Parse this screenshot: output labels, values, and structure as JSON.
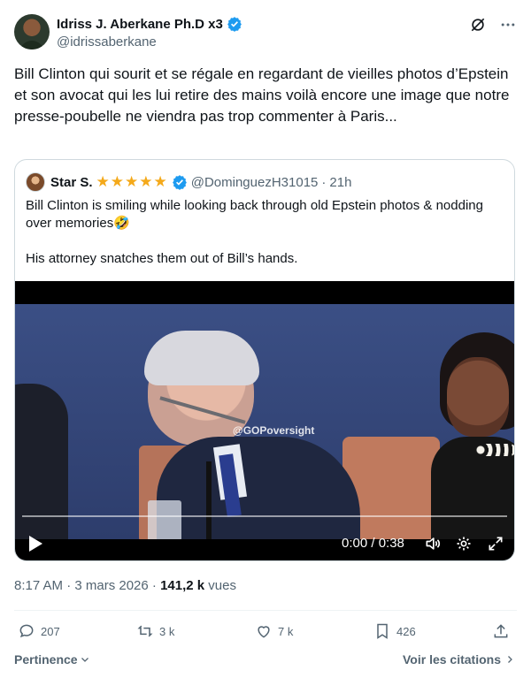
{
  "author": {
    "name": "Idriss J. Aberkane Ph.D x3",
    "handle": "@idrissaberkane"
  },
  "tweet": {
    "text": "Bill Clinton qui sourit et se régale en regardant de vieilles photos d’Epstein et son avocat qui les lui retire des mains voilà encore une image que notre presse-poubelle ne viendra pas trop commenter à Paris..."
  },
  "quote": {
    "name": "Star S.",
    "stars": "★★★★★",
    "handle": "@DominguezH31015",
    "separator": "·",
    "time": "21h",
    "text_line1": "Bill Clinton is smiling while looking back through old Epstein photos & nodding over memories🤣",
    "text_line2": "His attorney snatches them out of Bill’s hands.",
    "video": {
      "watermark": "@GOPoversight",
      "time": "0:00 / 0:38",
      "progress": 0.0
    }
  },
  "meta": {
    "timestamp": "8:17 AM · 3 mars 2026 · ",
    "views_count": "141,2 k",
    "views_label": " vues"
  },
  "actions": {
    "replies": "207",
    "reposts": "3 k",
    "likes": "7 k",
    "bookmarks": "426"
  },
  "footer": {
    "relevance": "Pertinence",
    "quotes": "Voir les citations"
  },
  "colors": {
    "verified": "#1d9bf0",
    "stars": "#f4a91a",
    "muted": "#536471"
  }
}
